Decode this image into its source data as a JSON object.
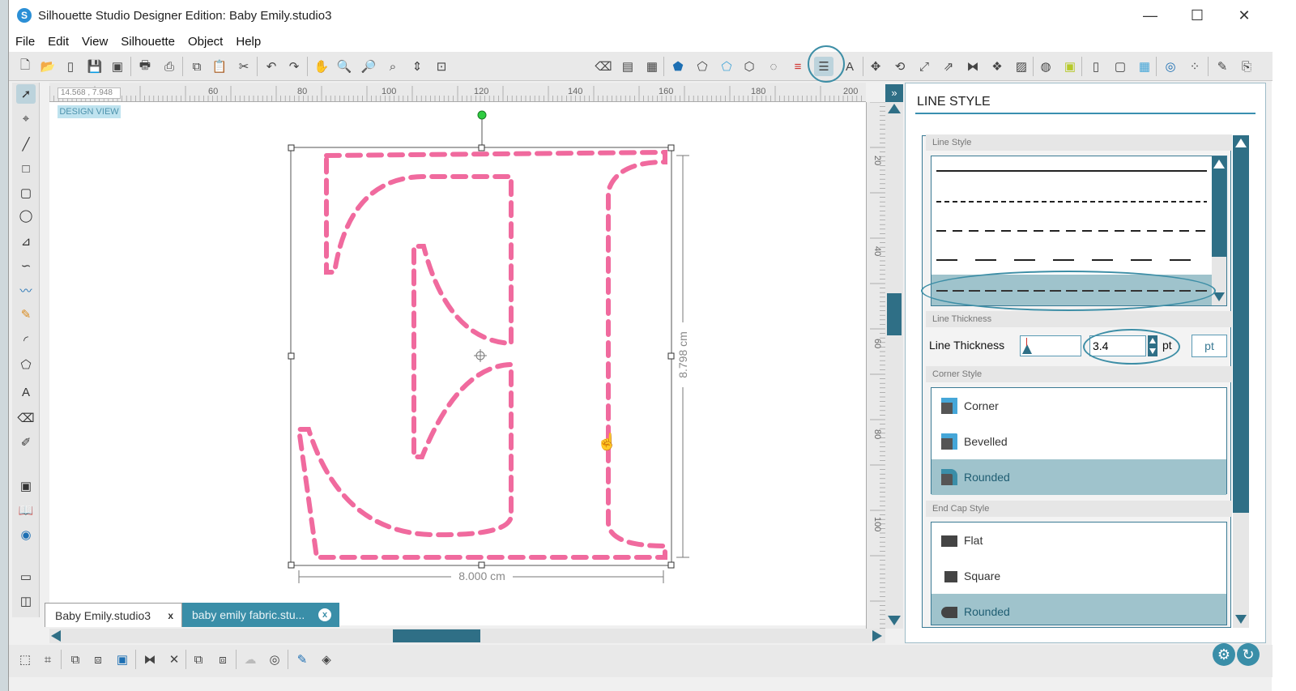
{
  "window": {
    "title": "Silhouette Studio Designer Edition: Baby Emily.studio3",
    "logo_glyph": "S",
    "minimize": "—",
    "maximize": "☐",
    "close": "✕"
  },
  "menu": [
    "File",
    "Edit",
    "View",
    "Silhouette",
    "Object",
    "Help"
  ],
  "canvas": {
    "coords": "14.568 , 7.948",
    "design_view_label": "DESIGN VIEW",
    "ruler_h_labels": [
      "60",
      "80",
      "100",
      "120",
      "140",
      "160",
      "180",
      "200"
    ],
    "ruler_v_labels": [
      "20",
      "40",
      "60",
      "80",
      "100"
    ],
    "width_label": "8.000 cm",
    "height_label": "8.798 cm",
    "letter_color": "#f06a9e"
  },
  "tabs": [
    {
      "label": "Baby Emily.studio3",
      "close": "x"
    },
    {
      "label": "baby emily fabric.stu...",
      "close": "x"
    }
  ],
  "panel": {
    "title": "LINE STYLE",
    "line_style_section": "Line Style",
    "thickness_section": "Line Thickness",
    "thickness_label": "Line Thickness",
    "thickness_value": "3.4",
    "thickness_unit": "pt",
    "thickness_unit_button": "pt",
    "corner_section": "Corner Style",
    "corner_options": [
      "Corner",
      "Bevelled",
      "Rounded"
    ],
    "endcap_section": "End Cap Style",
    "endcap_options": [
      "Flat",
      "Square",
      "Rounded"
    ],
    "accent_color": "#3a7a94",
    "selected_color": "#9fc3cc"
  }
}
